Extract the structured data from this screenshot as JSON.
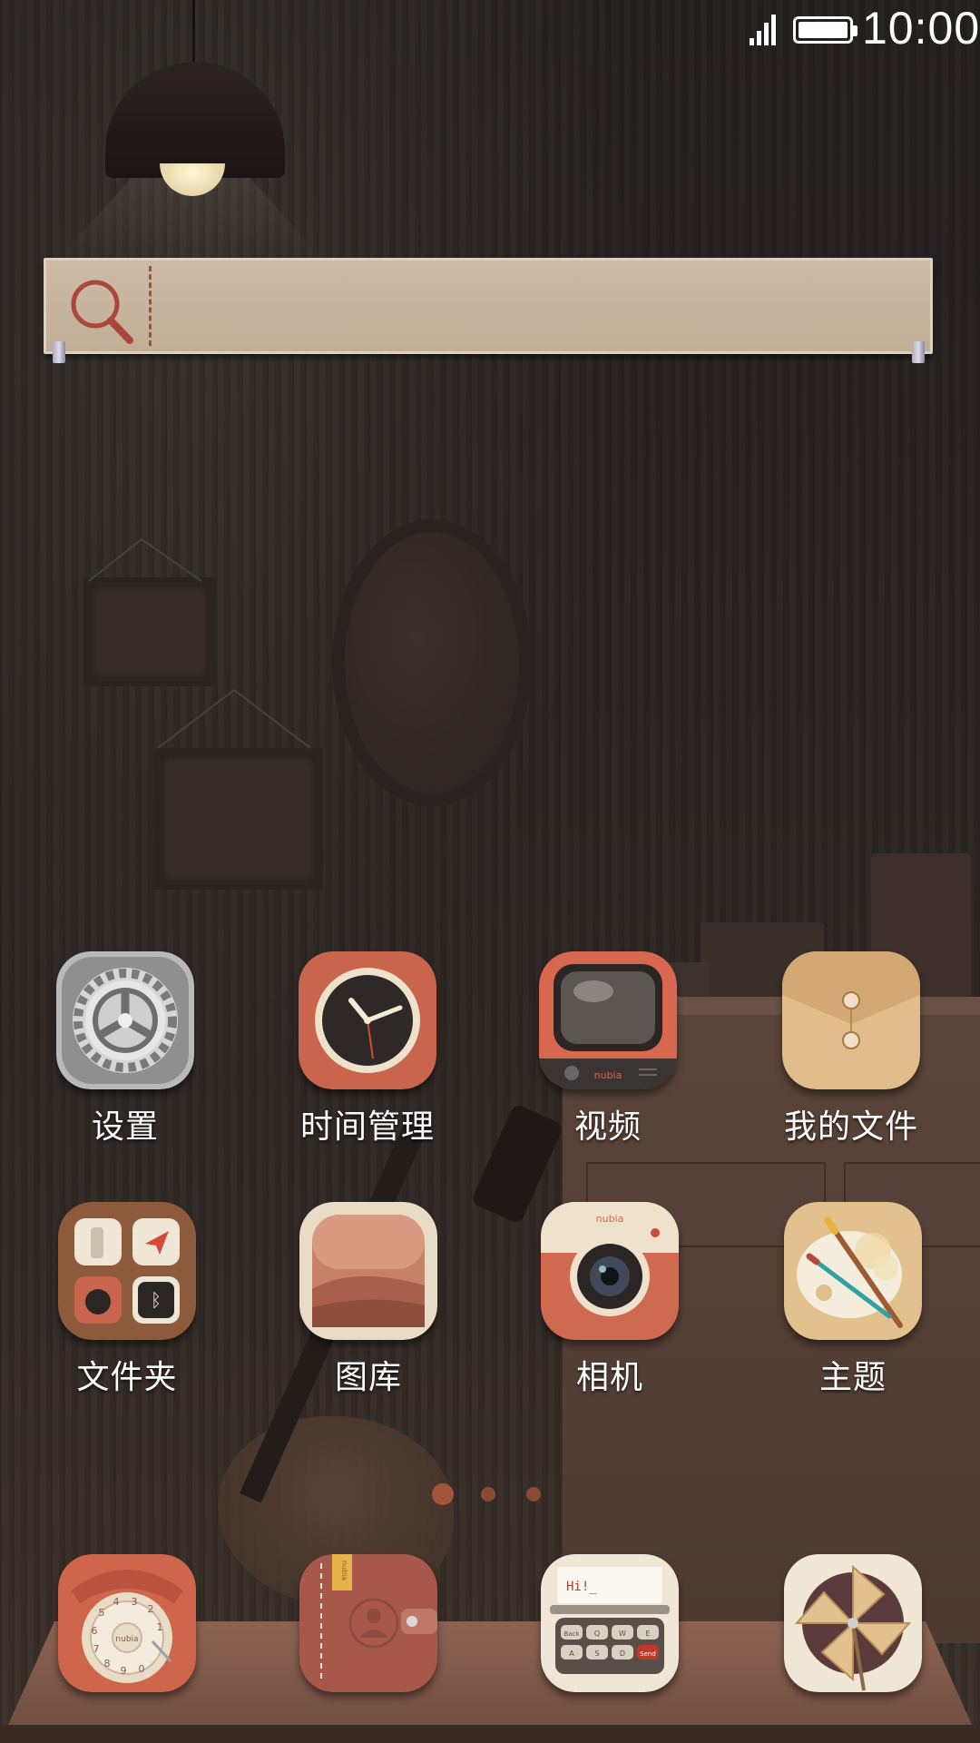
{
  "status_bar": {
    "time": "10:00",
    "signal_icon": "signal-icon",
    "battery_icon": "battery-icon",
    "battery_level": 1.0
  },
  "search": {
    "placeholder": "",
    "icon": "search-icon"
  },
  "apps": [
    {
      "label": "设置",
      "icon": "gear-icon"
    },
    {
      "label": "时间管理",
      "icon": "clock-icon"
    },
    {
      "label": "视频",
      "icon": "tv-icon"
    },
    {
      "label": "我的文件",
      "icon": "envelope-icon"
    },
    {
      "label": "文件夹",
      "icon": "folder-grid-icon"
    },
    {
      "label": "图库",
      "icon": "picture-frame-icon"
    },
    {
      "label": "相机",
      "icon": "camera-icon"
    },
    {
      "label": "主题",
      "icon": "palette-icon"
    }
  ],
  "dock": [
    {
      "icon": "phone-icon",
      "brand": "nubia",
      "dial_digits": [
        "1",
        "2",
        "3",
        "4",
        "5",
        "6",
        "7",
        "8",
        "9",
        "0"
      ]
    },
    {
      "icon": "contacts-book-icon",
      "brand": "nubia"
    },
    {
      "icon": "typewriter-icon",
      "screen_text": "Hi!_",
      "keys": [
        "Back",
        "Q",
        "W",
        "E",
        "A",
        "S",
        "D",
        "Send"
      ]
    },
    {
      "icon": "pinwheel-icon"
    }
  ],
  "brand_text": {
    "tv": "nubia",
    "camera": "nubia"
  },
  "page_indicator": {
    "count": 3,
    "current": 1
  },
  "colors": {
    "accent": "#c86a52",
    "search_bg": "#c8b59f",
    "label": "#ffffff"
  }
}
